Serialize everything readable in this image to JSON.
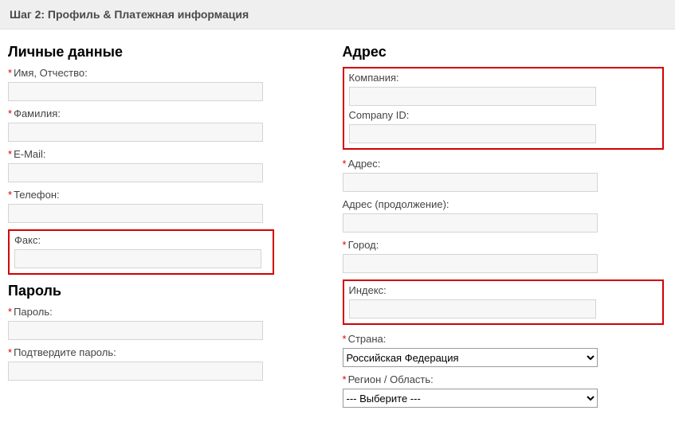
{
  "step_header": "Шаг 2: Профиль & Платежная информация",
  "left": {
    "personal_title": "Личные данные",
    "firstname_label": "Имя, Отчество:",
    "lastname_label": "Фамилия:",
    "email_label": "E-Mail:",
    "phone_label": "Телефон:",
    "fax_label": "Факс:",
    "password_title": "Пароль",
    "password_label": "Пароль:",
    "confirm_label": "Подтвердите пароль:"
  },
  "right": {
    "address_title": "Адрес",
    "company_label": "Компания:",
    "company_id_label": "Company ID:",
    "address1_label": "Адрес:",
    "address2_label": "Адрес (продолжение):",
    "city_label": "Город:",
    "index_label": "Индекс:",
    "country_label": "Страна:",
    "country_options": [
      "Российская Федерация"
    ],
    "region_label": "Регион / Область:",
    "region_options": [
      "--- Выберите ---"
    ]
  }
}
